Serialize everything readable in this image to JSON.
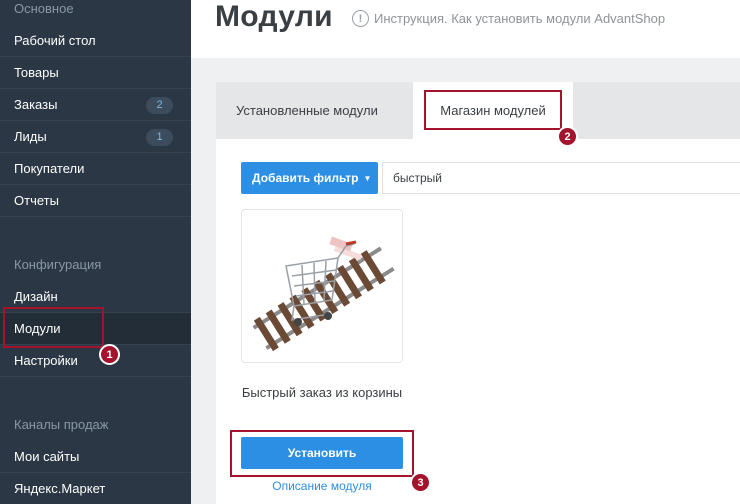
{
  "sidebar": {
    "section_main": "Основное",
    "items_main": [
      {
        "label": "Рабочий стол",
        "badge": ""
      },
      {
        "label": "Товары",
        "badge": ""
      },
      {
        "label": "Заказы",
        "badge": "2"
      },
      {
        "label": "Лиды",
        "badge": "1"
      },
      {
        "label": "Покупатели",
        "badge": ""
      },
      {
        "label": "Отчеты",
        "badge": ""
      }
    ],
    "section_config": "Конфигурация",
    "items_config": [
      {
        "label": "Дизайн"
      },
      {
        "label": "Модули"
      },
      {
        "label": "Настройки"
      }
    ],
    "section_channels": "Каналы продаж",
    "items_channels": [
      {
        "label": "Мои сайты"
      },
      {
        "label": "Яндекс.Маркет"
      }
    ]
  },
  "header": {
    "title": "Модули",
    "instruction_link": "Инструкция. Как установить модули AdvantShop"
  },
  "tabs": [
    {
      "label": "Установленные модули"
    },
    {
      "label": "Магазин модулей"
    }
  ],
  "filter": {
    "add_filter_label": "Добавить фильтр",
    "search_value": "быстрый"
  },
  "module": {
    "name": "Быстрый заказ из корзины",
    "install_label": "Установить",
    "description_link": "Описание модуля"
  },
  "annotations": [
    "1",
    "2",
    "3"
  ],
  "colors": {
    "sidebar_bg": "#2b3744",
    "accent": "#2d8fe4",
    "annotation": "#a3132c"
  }
}
